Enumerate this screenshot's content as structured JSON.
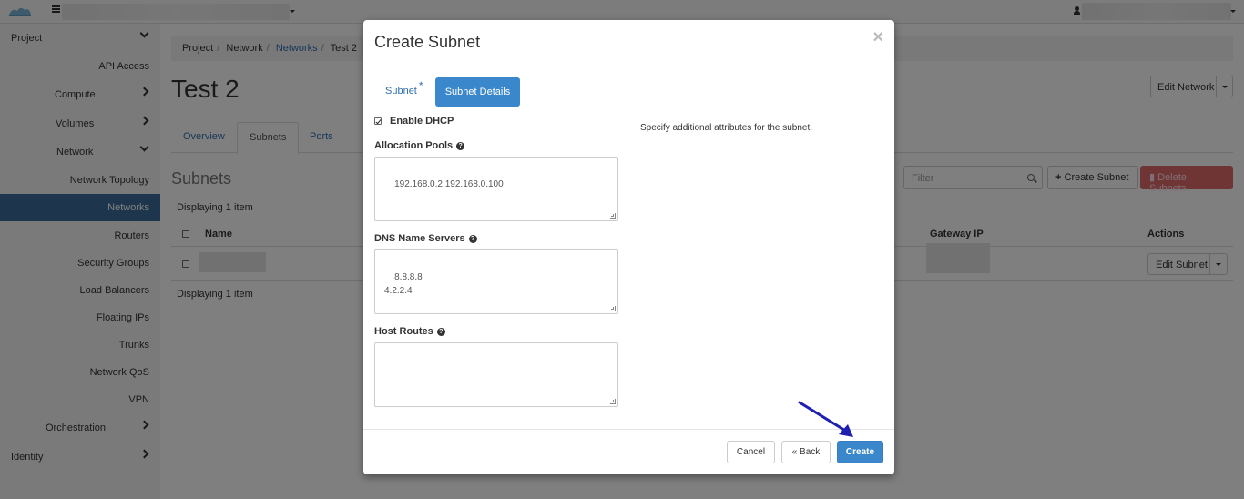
{
  "sidebar": {
    "items": [
      {
        "label": "Project"
      },
      {
        "label": "API Access"
      },
      {
        "label": "Compute"
      },
      {
        "label": "Volumes"
      },
      {
        "label": "Network"
      },
      {
        "label": "Network Topology"
      },
      {
        "label": "Networks"
      },
      {
        "label": "Routers"
      },
      {
        "label": "Security Groups"
      },
      {
        "label": "Load Balancers"
      },
      {
        "label": "Floating IPs"
      },
      {
        "label": "Trunks"
      },
      {
        "label": "Network QoS"
      },
      {
        "label": "VPN"
      },
      {
        "label": "Orchestration"
      },
      {
        "label": "Identity"
      }
    ]
  },
  "breadcrumb": {
    "items": [
      "Project",
      "Network",
      "Networks",
      "Test 2"
    ]
  },
  "page": {
    "title": "Test 2",
    "edit_network_label": "Edit Network",
    "tabs": [
      "Overview",
      "Subnets",
      "Ports"
    ],
    "section_title": "Subnets",
    "filter_placeholder": "Filter",
    "create_subnet_label": "Create Subnet",
    "delete_subnets_label": "Delete Subnets",
    "displaying": "Displaying 1 item",
    "table_headers": {
      "name": "Name",
      "gateway_ip": "Gateway IP",
      "actions": "Actions"
    },
    "edit_subnet_label": "Edit Subnet"
  },
  "modal": {
    "title": "Create Subnet",
    "close_glyph": "×",
    "tab_subnet": "Subnet",
    "tab_subnet_required": "*",
    "tab_subnet_details": "Subnet Details",
    "enable_dhcp_label": "Enable DHCP",
    "enable_dhcp_checked": true,
    "allocation_pools_label": "Allocation Pools",
    "allocation_pools_value": "192.168.0.2,192.168.0.100",
    "dns_label": "DNS Name Servers",
    "dns_value": "8.8.8.8\n4.2.2.4",
    "host_routes_label": "Host Routes",
    "host_routes_value": "",
    "help_text": "Specify additional attributes for the subnet.",
    "cancel_label": "Cancel",
    "back_label": "« Back",
    "create_label": "Create"
  },
  "colors": {
    "primary": "#3a87cc",
    "sidebar_active": "#3d6d9b",
    "danger": "#dd6a68",
    "annotation_arrow": "#1f1fb0"
  }
}
